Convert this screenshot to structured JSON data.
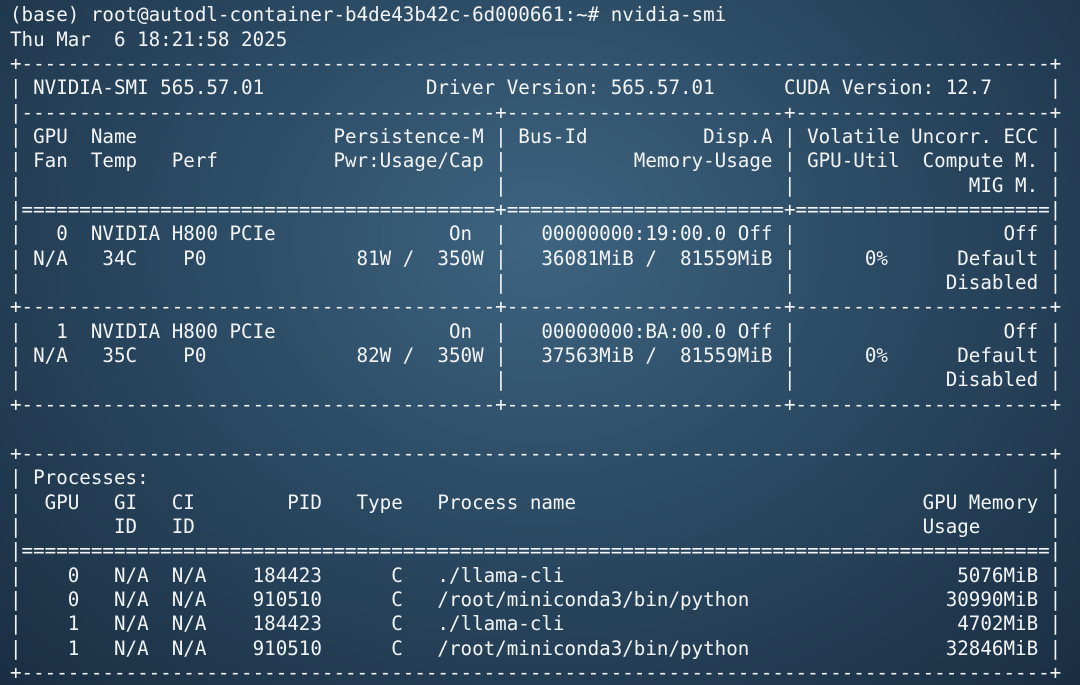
{
  "terminal": {
    "lines": [
      "(base) root@autodl-container-b4de43b42c-6d000661:~# nvidia-smi",
      "Thu Mar  6 18:21:58 2025",
      "+-----------------------------------------------------------------------------------------+",
      "| NVIDIA-SMI 565.57.01              Driver Version: 565.57.01      CUDA Version: 12.7     |",
      "|-----------------------------------------+------------------------+----------------------+",
      "| GPU  Name                 Persistence-M | Bus-Id          Disp.A | Volatile Uncorr. ECC |",
      "| Fan  Temp   Perf          Pwr:Usage/Cap |           Memory-Usage | GPU-Util  Compute M. |",
      "|                                         |                        |               MIG M. |",
      "|=========================================+========================+======================|",
      "|   0  NVIDIA H800 PCIe               On  |   00000000:19:00.0 Off |                  Off |",
      "| N/A   34C    P0             81W /  350W |   36081MiB /  81559MiB |      0%      Default |",
      "|                                         |                        |             Disabled |",
      "+-----------------------------------------+------------------------+----------------------+",
      "|   1  NVIDIA H800 PCIe               On  |   00000000:BA:00.0 Off |                  Off |",
      "| N/A   35C    P0             82W /  350W |   37563MiB /  81559MiB |      0%      Default |",
      "|                                         |                        |             Disabled |",
      "+-----------------------------------------+------------------------+----------------------+",
      "",
      "",
      "+-----------------------------------------------------------------------------------------+",
      "| Processes:                                                                              |",
      "|  GPU   GI   CI        PID   Type   Process name                              GPU Memory |",
      "|        ID   ID                                                               Usage      |",
      "|=========================================================================================|",
      "|    0   N/A  N/A    184423      C   ./llama-cli                                  5076MiB |",
      "|    0   N/A  N/A    910510      C   /root/miniconda3/bin/python                 30990MiB |",
      "|    1   N/A  N/A    184423      C   ./llama-cli                                  4702MiB |",
      "|    1   N/A  N/A    910510      C   /root/miniconda3/bin/python                 32846MiB |",
      "+-----------------------------------------------------------------------------------------+"
    ]
  }
}
